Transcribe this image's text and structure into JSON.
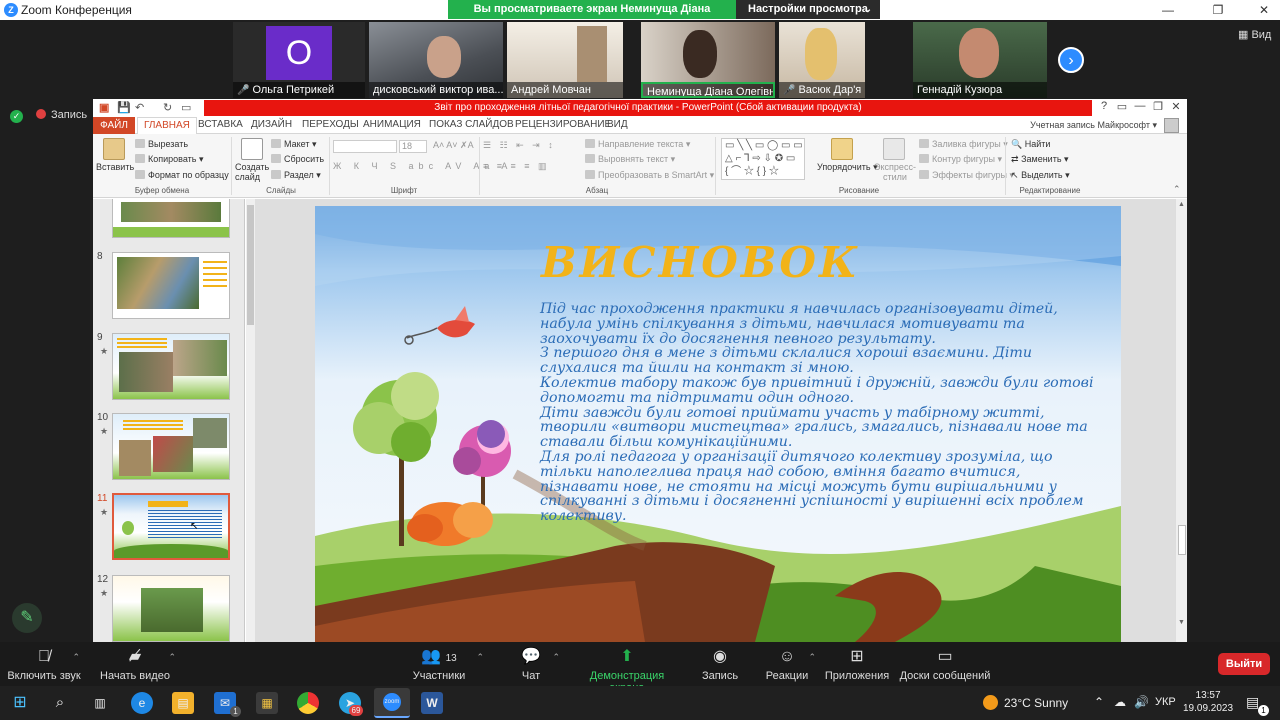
{
  "zoom": {
    "window_title": "Zoom Конференция",
    "logo": "Z",
    "share_banner": "Вы просматриваете экран Неминуща Діана Олегівна",
    "view_settings": "Настройки просмотра",
    "view_label": "Вид",
    "record_label": "Запись",
    "participants": [
      {
        "name": "Ольга Петрикей",
        "avatar_letter": "O",
        "muted": true,
        "color": "#6a2cc9"
      },
      {
        "name": "дисковський виктор ива...",
        "muted": false
      },
      {
        "name": "Андрей Мовчан",
        "muted": false
      },
      {
        "name": "Неминуща Діана Олегівна",
        "muted": false
      },
      {
        "name": "Васюк Дар'я",
        "muted": true
      },
      {
        "name": "Геннадій Кузюра",
        "muted": false
      }
    ],
    "toolbar": {
      "audio": "Включить звук",
      "video": "Начать видео",
      "participants": "Участники",
      "participants_count": "13",
      "chat": "Чат",
      "share": "Демонстрация экрана",
      "record": "Запись",
      "reactions": "Реакции",
      "apps": "Приложения",
      "whiteboard": "Доски сообщений",
      "leave": "Выйти"
    }
  },
  "ppt": {
    "title": "Звіт про проходження літньої педагогічної  практики -  PowerPoint (Сбой активации продукта)",
    "account": "Учетная запись Майкрософт",
    "tabs": [
      "ФАЙЛ",
      "ГЛАВНАЯ",
      "ВСТАВКА",
      "ДИЗАЙН",
      "ПЕРЕХОДЫ",
      "АНИМАЦИЯ",
      "ПОКАЗ СЛАЙДОВ",
      "РЕЦЕНЗИРОВАНИЕ",
      "ВИД"
    ],
    "ribbon": {
      "paste": "Вставить",
      "cut": "Вырезать",
      "copy": "Копировать",
      "format_painter": "Формат по образцу",
      "clipboard_group": "Буфер обмена",
      "new_slide": "Создать слайд",
      "layout": "Макет",
      "reset": "Сбросить",
      "section": "Раздел",
      "slides_group": "Слайды",
      "font_size": "18",
      "font_group": "Шрифт",
      "text_direction": "Направление текста",
      "align_text": "Выровнять текст",
      "smartart": "Преобразовать в SmartArt",
      "paragraph_group": "Абзац",
      "arrange": "Упорядочить",
      "quick_styles": "Экспресс-стили",
      "shape_fill": "Заливка фигуры",
      "shape_outline": "Контур фигуры",
      "shape_effects": "Эффекты фигуры",
      "drawing_group": "Рисование",
      "find": "Найти",
      "replace": "Заменить",
      "select": "Выделить",
      "editing_group": "Редактирование"
    },
    "thumbnails": [
      {
        "num": "8"
      },
      {
        "num": "9"
      },
      {
        "num": "10"
      },
      {
        "num": "11"
      },
      {
        "num": "12"
      }
    ],
    "slide": {
      "title": "ВИСНОВОК",
      "body": [
        "Під час проходження практики я навчилась організовувати дітей, набула умінь спілкування з дітьми, навчилася мотивувати та заохочувати їх до досягнення певного результату.",
        "З першого дня в мене з дітьми склалися хороші взаємини. Діти слухалися та йшли на контакт зі мною.",
        "Колектив табору також був привітний і дружній, завжди були готові допомогти та підтримати один одного.",
        "Діти завжди були готові приймати участь у табірному житті, творили «витвори мистецтва» грались, змагались, пізнавали нове та ставали більш комунікаційними.",
        "Для ролі педагога у організації дитячого колективу зрозуміла, що тільки наполеглива праця над собою, вміння багато вчитися, пізнавати нове, не стояти на місці можуть бути вирішальними у спілкуванні з дітьми  і досягненні успішності у вирішенні всіх проблем колективу."
      ]
    }
  },
  "taskbar": {
    "weather": "23°C  Sunny",
    "lang": "УКР",
    "time": "13:57",
    "date": "19.09.2023",
    "telegram_badge": "69",
    "mail_badge": "1",
    "notif_badge": "1"
  }
}
